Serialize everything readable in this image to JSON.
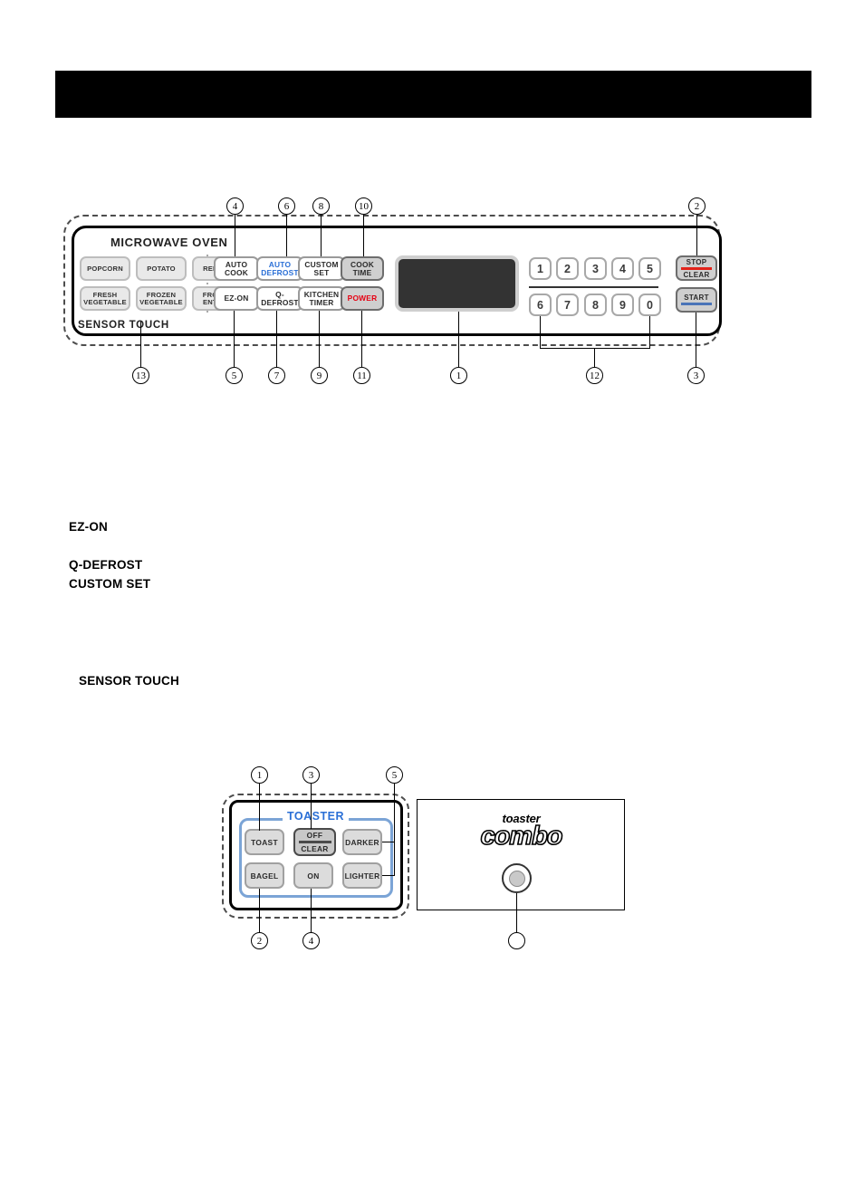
{
  "header": {
    "bar_color": "#000000"
  },
  "microwave": {
    "title": "MICROWAVE OVEN",
    "sensor_touch_label": "SENSOR TOUCH",
    "sensor_buttons": [
      {
        "label": "POPCORN"
      },
      {
        "label": "POTATO"
      },
      {
        "label": "REHEAT"
      },
      {
        "label": "FRESH\nVEGETABLE",
        "line1": "FRESH",
        "line2": "VEGETABLE"
      },
      {
        "label": "FROZEN\nVEGETABLE",
        "line1": "FROZEN",
        "line2": "VEGETABLE"
      },
      {
        "label": "FROZEN\nENTREE",
        "line1": "FROZEN",
        "line2": "ENTREE"
      }
    ],
    "function_buttons": [
      {
        "line1": "AUTO",
        "line2": "COOK",
        "color": "#2b2b2b"
      },
      {
        "line1": "AUTO",
        "line2": "DEFROST",
        "color": "#2a6fd6"
      },
      {
        "line1": "CUSTOM",
        "line2": "SET",
        "color": "#2b2b2b"
      },
      {
        "line1": "COOK",
        "line2": "TIME",
        "color": "#2b2b2b"
      },
      {
        "line1": "EZ-ON",
        "line2": "",
        "color": "#2b2b2b"
      },
      {
        "line1": "Q-",
        "line2": "DEFROST",
        "color": "#2b2b2b"
      },
      {
        "line1": "KITCHEN",
        "line2": "TIMER",
        "color": "#2b2b2b"
      },
      {
        "line1": "POWER",
        "line2": "",
        "color": "#e60012"
      }
    ],
    "keypad": [
      "1",
      "2",
      "3",
      "4",
      "5",
      "6",
      "7",
      "8",
      "9",
      "0"
    ],
    "stop_clear": {
      "line1": "STOP",
      "line2": "CLEAR",
      "rule_color": "#e2231a"
    },
    "start": {
      "label": "START",
      "rule_color": "#4a74b8"
    },
    "callouts_top": [
      "4",
      "6",
      "8",
      "10",
      "2"
    ],
    "callouts_bottom": [
      "13",
      "5",
      "7",
      "9",
      "11",
      "1",
      "12",
      "3"
    ]
  },
  "body_text": {
    "ez_on": "EZ-ON",
    "q_defrost": "Q-DEFROST",
    "custom_set": "CUSTOM SET",
    "sensor_touch": "SENSOR TOUCH"
  },
  "toaster": {
    "legend": "TOASTER",
    "buttons": [
      {
        "label": "TOAST"
      },
      {
        "label": "BAGEL"
      },
      {
        "line1": "OFF",
        "line2": "CLEAR"
      },
      {
        "label": "ON"
      },
      {
        "label": "DARKER"
      },
      {
        "label": "LIGHTER"
      }
    ],
    "logo_top": "toaster",
    "logo_main": "combo",
    "callouts_top": [
      "1",
      "3",
      "5"
    ],
    "callouts_bottom": [
      "2",
      "4"
    ]
  },
  "colors": {
    "accent_blue": "#2a6fd6",
    "power_red": "#e60012",
    "panel_border_blue": "#7ba4d6",
    "display": "#333333"
  }
}
